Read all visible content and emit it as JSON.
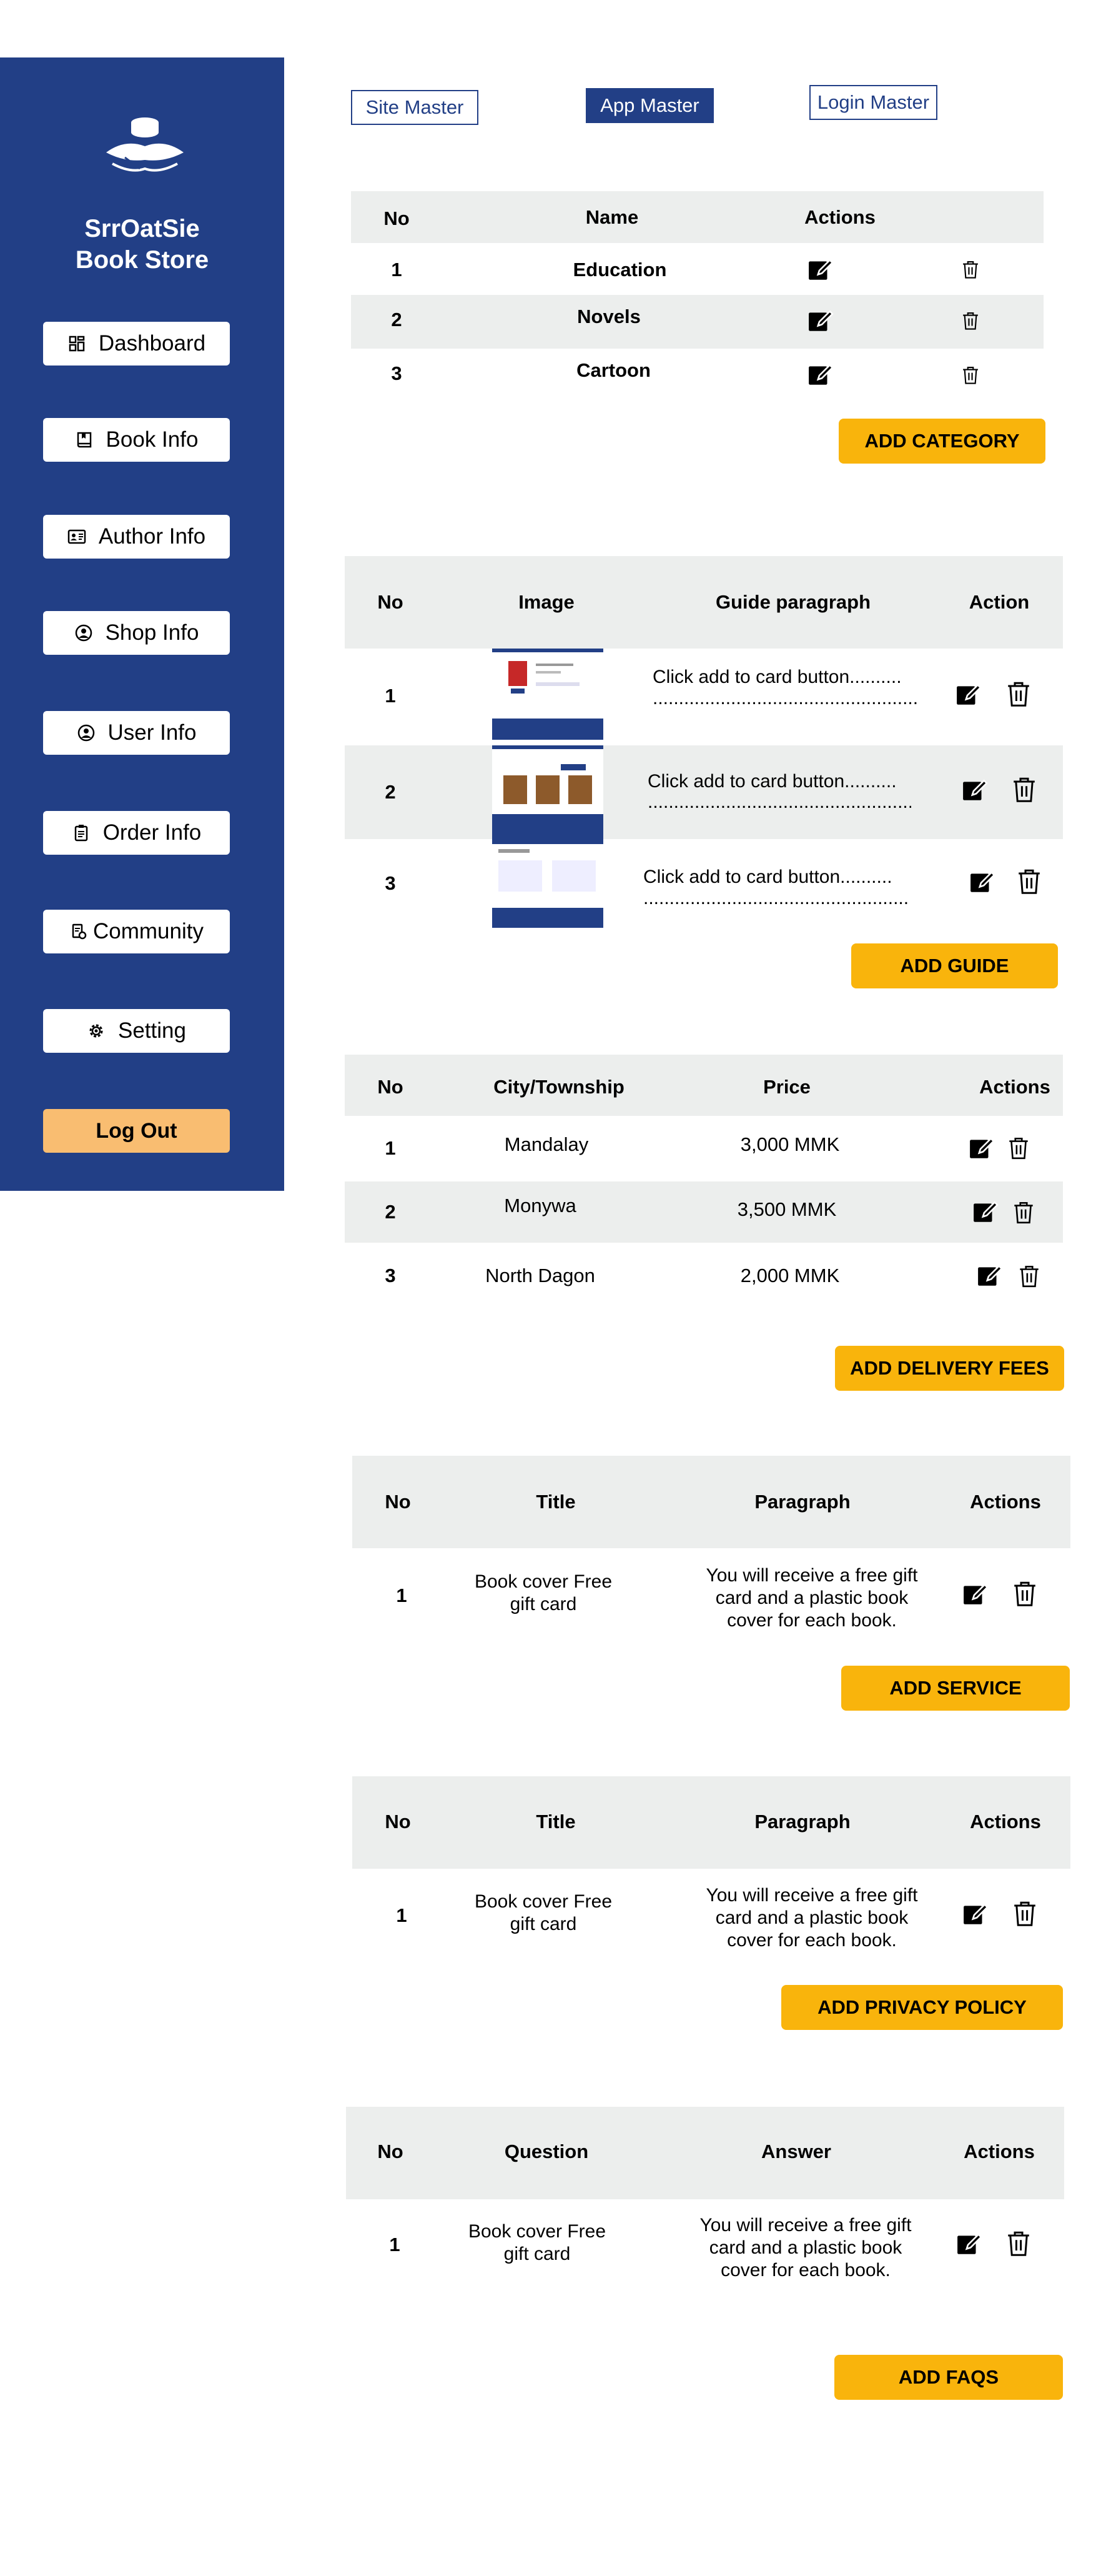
{
  "sidebar": {
    "brand_line1": "SrrOatSie",
    "brand_line2": "Book Store",
    "items": [
      {
        "label": "Dashboard"
      },
      {
        "label": "Book Info"
      },
      {
        "label": "Author Info"
      },
      {
        "label": "Shop Info"
      },
      {
        "label": "User Info"
      },
      {
        "label": "Order Info"
      },
      {
        "label": "Community"
      },
      {
        "label": "Setting"
      }
    ],
    "logout": "Log Out"
  },
  "tabs": [
    {
      "label": "Site Master"
    },
    {
      "label": "App Master"
    },
    {
      "label": "Login Master"
    }
  ],
  "category": {
    "headers": [
      "No",
      "Name",
      "Actions"
    ],
    "rows": [
      {
        "no": "1",
        "name": "Education"
      },
      {
        "no": "2",
        "name": "Novels"
      },
      {
        "no": "3",
        "name": "Cartoon"
      }
    ],
    "button": "ADD CATEGORY"
  },
  "guide": {
    "headers": [
      "No",
      "Image",
      "Guide paragraph",
      "Action"
    ],
    "rows": [
      {
        "no": "1",
        "text": "Click add to card button..........",
        "dots": "......................................................................"
      },
      {
        "no": "2",
        "text": "Click add to card button..........",
        "dots": "......................................................................"
      },
      {
        "no": "3",
        "text": "Click add to card button..........",
        "dots": "......................................................................"
      }
    ],
    "button": "ADD GUIDE"
  },
  "delivery": {
    "headers": [
      "No",
      "City/Township",
      "Price",
      "Actions"
    ],
    "rows": [
      {
        "no": "1",
        "city": "Mandalay",
        "price": "3,000 MMK"
      },
      {
        "no": "2",
        "city": "Monywa",
        "price": "3,500 MMK"
      },
      {
        "no": "3",
        "city": "North Dagon",
        "price": "2,000 MMK"
      }
    ],
    "button": "ADD DELIVERY FEES"
  },
  "service": {
    "headers": [
      "No",
      "Title",
      "Paragraph",
      "Actions"
    ],
    "row": {
      "no": "1",
      "title1": "Book cover Free",
      "title2": "gift card",
      "p1": "You will receive a free gift",
      "p2": "card and a plastic book",
      "p3": "cover for each book."
    },
    "button": "ADD SERVICE"
  },
  "privacy": {
    "headers": [
      "No",
      "Title",
      "Paragraph",
      "Actions"
    ],
    "row": {
      "no": "1",
      "title1": "Book cover Free",
      "title2": "gift card",
      "p1": "You will receive a free gift",
      "p2": "card and a plastic book",
      "p3": "cover for each book."
    },
    "button": "ADD PRIVACY POLICY"
  },
  "faqs": {
    "headers": [
      "No",
      "Question",
      "Answer",
      "Actions"
    ],
    "row": {
      "no": "1",
      "title1": "Book cover Free",
      "title2": "gift card",
      "p1": "You will receive a free gift",
      "p2": "card and a plastic book",
      "p3": "cover for each book."
    },
    "button": "ADD FAQS"
  },
  "colors": {
    "primary": "#223f86",
    "accent": "#f9b40c",
    "logout": "#f9bd71",
    "band": "#eceeed"
  },
  "icons": {
    "edit": "edit-icon",
    "delete": "trash-icon"
  }
}
